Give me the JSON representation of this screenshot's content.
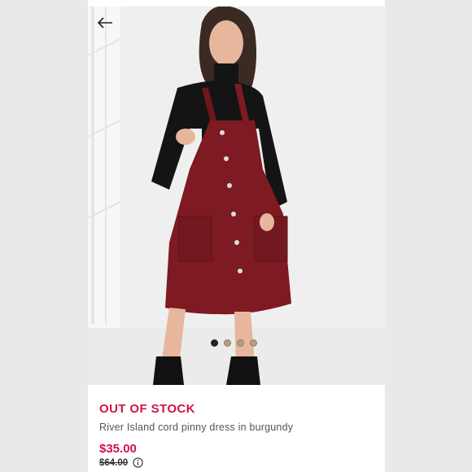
{
  "product": {
    "status": "OUT OF STOCK",
    "name": "River Island cord pinny dress in burgundy",
    "price": "$35.00",
    "was_price": "$64.00"
  },
  "gallery": {
    "image_count": 4,
    "active_index": 0
  },
  "colors": {
    "accent": "#d01345",
    "dress": "#7d1a22"
  },
  "icons": {
    "back": "arrow-left-icon",
    "info": "info-circle-icon"
  }
}
